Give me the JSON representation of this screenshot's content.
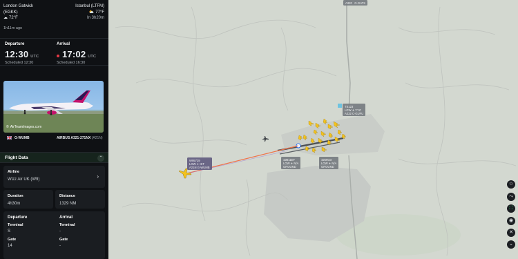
{
  "route": {
    "origin_name": "London Gatwick",
    "origin_code": "(EGKK)",
    "origin_temp": "72°F",
    "destination_name": "Istanbul (LTFM)",
    "destination_temp": "77°F",
    "eta_text": "In 3h20m",
    "ago_text": "1h11m ago"
  },
  "times": {
    "departure_label": "Departure",
    "departure_time": "12:30",
    "departure_tz": "UTC",
    "departure_sched": "Scheduled 12:30",
    "arrival_label": "Arrival",
    "arrival_time": "17:02",
    "arrival_tz": "UTC",
    "arrival_sched": "Scheduled 16:30"
  },
  "photo": {
    "credit": "AirTeamImages.com"
  },
  "aircraft": {
    "registration": "G-WUMB",
    "type": "AIRBUS A321-271NX",
    "type_code": "(A21N)"
  },
  "flight_data": {
    "section_title": "Flight Data",
    "airline_label": "Airline",
    "airline_value": "Wizz Air UK (W9)",
    "duration_label": "Duration",
    "duration_value": "4h30m",
    "distance_label": "Distance",
    "distance_value": "1329 NM",
    "departure_label": "Departure",
    "arrival_label": "Arrival",
    "dep_terminal_label": "Terminal",
    "dep_terminal_value": "S",
    "arr_terminal_label": "Terminal",
    "arr_terminal_value": "-",
    "dep_gate_label": "Gate",
    "dep_gate_value": "14",
    "arr_gate_label": "Gate",
    "arr_gate_value": "-"
  },
  "map": {
    "tags": {
      "top_1": "A320",
      "top_2": "G-GATS",
      "t1_line1": "TS123",
      "t1_line2": "LGW ✈ YYZ",
      "t1_line3": "A332   C-GUFU",
      "sel_line1": "W95729",
      "sel_line2": "LGW ✈ IST",
      "sel_line3": "A21N   G-WUMB",
      "g1_line1": "4JB11EF",
      "g1_line2": "LGW ✈ N/A",
      "g1_line3": "GROUND",
      "g2_line1": "4259CD",
      "g2_line2": "LGW ✈ N/A",
      "g2_line3": "GROUND"
    },
    "colors": {
      "selected_trail": "#f0744a",
      "aircraft": "#f3c21d",
      "runway": "#4a4f55"
    },
    "controls": [
      "star-icon",
      "route-icon",
      "expand-icon",
      "locate-icon",
      "close-icon",
      "down-icon"
    ]
  }
}
